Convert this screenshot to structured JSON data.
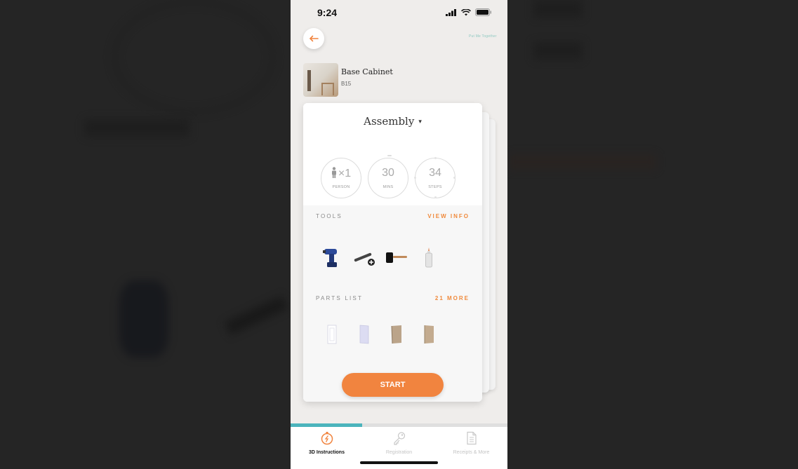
{
  "status_bar": {
    "time": "9:24",
    "icons": [
      "signal-icon",
      "wifi-icon",
      "battery-icon"
    ]
  },
  "header": {
    "back_icon": "arrow-left-icon",
    "brand_mark": "Put Me Together"
  },
  "product": {
    "title": "Base Cabinet",
    "sku": "B15",
    "thumbnail": "kitchen-photo"
  },
  "card": {
    "mode_label": "Assembly",
    "mode_caret": "▾",
    "stats": [
      {
        "value": "×1",
        "label": "PERSON",
        "icon": "person-icon"
      },
      {
        "value": "30",
        "label": "MINS"
      },
      {
        "value": "34",
        "label": "STEPS"
      }
    ],
    "tools": {
      "title": "TOOLS",
      "link": "VIEW INFO",
      "items": [
        "drill-icon",
        "phillips-bit-icon",
        "mallet-icon",
        "glue-bottle-icon"
      ]
    },
    "parts": {
      "title": "PARTS LIST",
      "link": "21 MORE",
      "items": [
        "white-frame-panel-icon",
        "white-panel-icon",
        "wood-panel-icon",
        "wood-side-panel-icon"
      ]
    },
    "start_label": "START"
  },
  "progress": {
    "percent": 33
  },
  "tabbar": {
    "tabs": [
      {
        "label": "3D Instructions",
        "icon": "compass-icon",
        "active": true
      },
      {
        "label": "Registration",
        "icon": "key-icon",
        "active": false
      },
      {
        "label": "Receipts & More",
        "icon": "document-icon",
        "active": false
      }
    ]
  },
  "colors": {
    "accent": "#f1843f",
    "progress": "#4bb4bc",
    "background": "#efedeb"
  }
}
